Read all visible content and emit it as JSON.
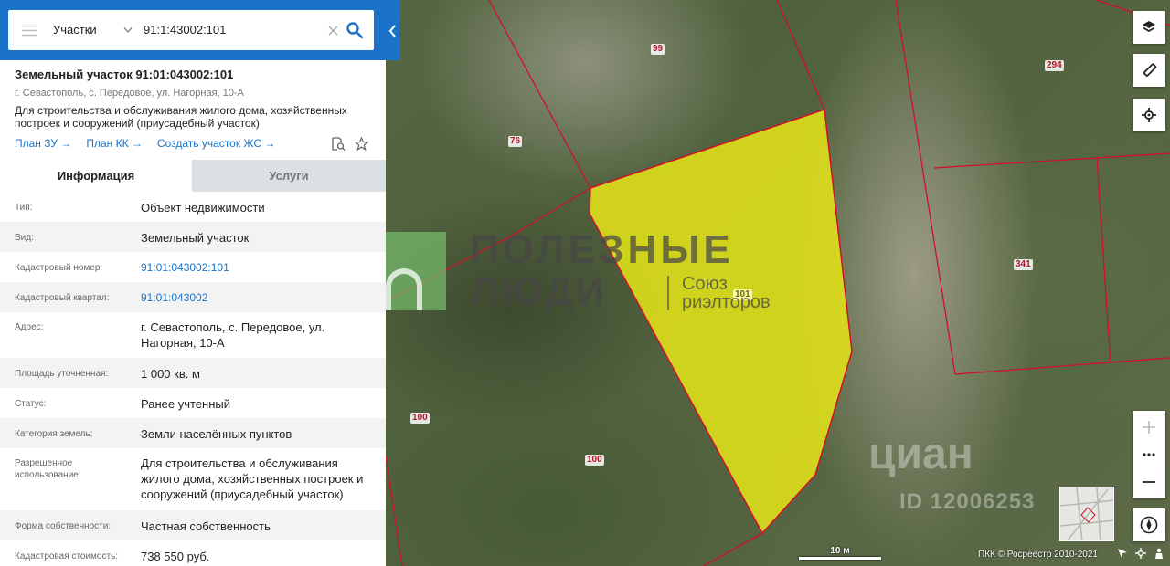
{
  "search": {
    "category": "Участки",
    "query": "91:1:43002:101"
  },
  "card": {
    "title": "Земельный участок 91:01:043002:101",
    "address": "г. Севастополь, с. Передовое, ул. Нагорная, 10-А",
    "purpose": "Для строительства и обслуживания жилого дома, хозяйственных построек и сооружений (приусадебный участок)",
    "links": [
      "План ЗУ →",
      "План КК →",
      "Создать участок ЖС →"
    ]
  },
  "tabs": [
    {
      "label": "Информация",
      "active": true
    },
    {
      "label": "Услуги",
      "active": false
    }
  ],
  "info": [
    {
      "key": "Тип:",
      "value": "Объект недвижимости"
    },
    {
      "key": "Вид:",
      "value": "Земельный участок"
    },
    {
      "key": "Кадастровый номер:",
      "value": "91:01:043002:101",
      "link": true
    },
    {
      "key": "Кадастровый квартал:",
      "value": "91:01:043002",
      "link": true
    },
    {
      "key": "Адрес:",
      "value": "г. Севастополь, с. Передовое, ул. Нагорная, 10-А"
    },
    {
      "key": "Площадь уточненная:",
      "value": "1 000 кв. м"
    },
    {
      "key": "Статус:",
      "value": "Ранее учтенный"
    },
    {
      "key": "Категория земель:",
      "value": "Земли населённых пунктов"
    },
    {
      "key": "Разрешенное использование:",
      "value": "Для строительства и обслуживания жилого дома, хозяйственных построек и сооружений (приусадебный участок)"
    },
    {
      "key": "Форма собственности:",
      "value": "Частная собственность"
    },
    {
      "key": "Кадастровая стоимость:",
      "value": "738 550 руб."
    }
  ],
  "map": {
    "parcel_labels": [
      "99",
      "294",
      "76",
      "341",
      "101",
      "100",
      "100"
    ],
    "scale_label": "10 м",
    "copyright": "ПКК © Росреестр 2010-2021"
  },
  "watermark": {
    "line1": "ПОЛЕЗНЫЕ",
    "line2": "ЛЮДИ",
    "sub1": "Союз",
    "sub2": "риэлторов"
  },
  "cian": {
    "logo": "циан",
    "id": "ID 12006253"
  },
  "colors": {
    "accent": "#1a73c8",
    "parcel_border": "#d0102a",
    "selected_parcel": "#e6e617"
  }
}
